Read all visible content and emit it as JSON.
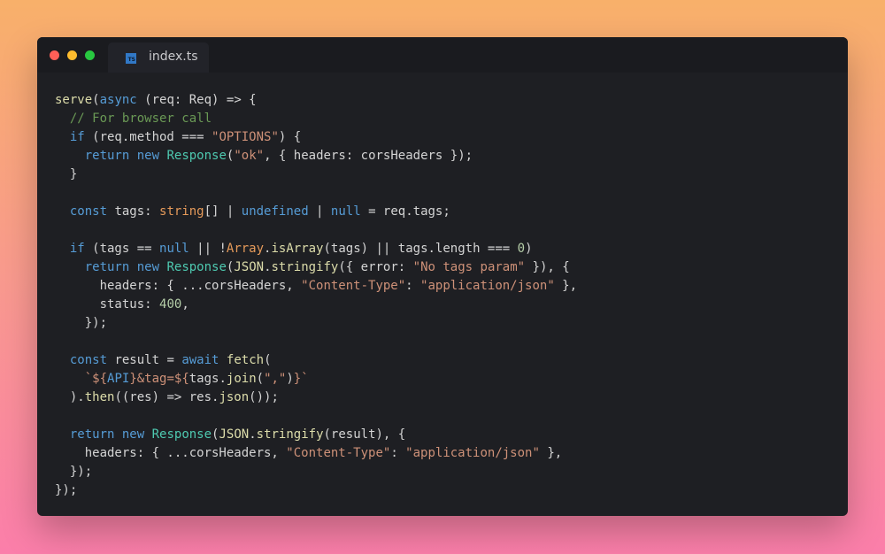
{
  "window": {
    "tab": {
      "filename": "index.ts",
      "icon": "typescript-file-icon",
      "icon_text": "TS"
    }
  },
  "colors": {
    "keyword": "#569cd6",
    "function": "#dcdcaa",
    "class": "#4ec9b0",
    "string": "#ce9178",
    "number": "#b5cea8",
    "comment": "#6a9955",
    "type": "#e59a5a",
    "plain": "#d4d4d4",
    "editor_background": "#1e1f23",
    "close_button": "#ff5f57",
    "minimize_button": "#febc2e",
    "maximize_button": "#28c840"
  },
  "code_lines": [
    [
      [
        "fn",
        "serve"
      ],
      [
        "pl",
        "("
      ],
      [
        "kw",
        "async"
      ],
      [
        "pl",
        " (req: Req) => {"
      ]
    ],
    [
      [
        "pl",
        "  "
      ],
      [
        "com",
        "// For browser call"
      ]
    ],
    [
      [
        "pl",
        "  "
      ],
      [
        "kw",
        "if"
      ],
      [
        "pl",
        " (req.method === "
      ],
      [
        "str",
        "\"OPTIONS\""
      ],
      [
        "pl",
        ") {"
      ]
    ],
    [
      [
        "pl",
        "    "
      ],
      [
        "kw",
        "return"
      ],
      [
        "pl",
        " "
      ],
      [
        "kw",
        "new"
      ],
      [
        "pl",
        " "
      ],
      [
        "cls",
        "Response"
      ],
      [
        "pl",
        "("
      ],
      [
        "str",
        "\"ok\""
      ],
      [
        "pl",
        ", { headers: corsHeaders });"
      ]
    ],
    [
      [
        "pl",
        "  }"
      ]
    ],
    [],
    [
      [
        "pl",
        "  "
      ],
      [
        "kw",
        "const"
      ],
      [
        "pl",
        " tags: "
      ],
      [
        "type",
        "string"
      ],
      [
        "pl",
        "[] | "
      ],
      [
        "kw",
        "undefined"
      ],
      [
        "pl",
        " | "
      ],
      [
        "kw",
        "null"
      ],
      [
        "pl",
        " = req.tags;"
      ]
    ],
    [],
    [
      [
        "pl",
        "  "
      ],
      [
        "kw",
        "if"
      ],
      [
        "pl",
        " (tags == "
      ],
      [
        "kw",
        "null"
      ],
      [
        "pl",
        " || !"
      ],
      [
        "type",
        "Array"
      ],
      [
        "pl",
        "."
      ],
      [
        "fn",
        "isArray"
      ],
      [
        "pl",
        "(tags) || tags.length === "
      ],
      [
        "num",
        "0"
      ],
      [
        "pl",
        ")"
      ]
    ],
    [
      [
        "pl",
        "    "
      ],
      [
        "kw",
        "return"
      ],
      [
        "pl",
        " "
      ],
      [
        "kw",
        "new"
      ],
      [
        "pl",
        " "
      ],
      [
        "cls",
        "Response"
      ],
      [
        "pl",
        "("
      ],
      [
        "fn",
        "JSON"
      ],
      [
        "pl",
        "."
      ],
      [
        "fn",
        "stringify"
      ],
      [
        "pl",
        "({ error: "
      ],
      [
        "str",
        "\"No tags param\""
      ],
      [
        "pl",
        " }), {"
      ]
    ],
    [
      [
        "pl",
        "      headers: { ...corsHeaders, "
      ],
      [
        "str",
        "\"Content-Type\""
      ],
      [
        "pl",
        ": "
      ],
      [
        "str",
        "\"application/json\""
      ],
      [
        "pl",
        " },"
      ]
    ],
    [
      [
        "pl",
        "      status: "
      ],
      [
        "num",
        "400"
      ],
      [
        "pl",
        ","
      ]
    ],
    [
      [
        "pl",
        "    });"
      ]
    ],
    [],
    [
      [
        "pl",
        "  "
      ],
      [
        "kw",
        "const"
      ],
      [
        "pl",
        " result = "
      ],
      [
        "kw",
        "await"
      ],
      [
        "pl",
        " "
      ],
      [
        "fn",
        "fetch"
      ],
      [
        "pl",
        "("
      ]
    ],
    [
      [
        "pl",
        "    "
      ],
      [
        "str",
        "`${"
      ],
      [
        "kw",
        "API"
      ],
      [
        "str",
        "}&tag=${"
      ],
      [
        "pl",
        "tags."
      ],
      [
        "fn",
        "join"
      ],
      [
        "pl",
        "("
      ],
      [
        "str",
        "\",\""
      ],
      [
        "pl",
        ")"
      ],
      [
        "str",
        "}`"
      ]
    ],
    [
      [
        "pl",
        "  )."
      ],
      [
        "fn",
        "then"
      ],
      [
        "pl",
        "((res) => res."
      ],
      [
        "fn",
        "json"
      ],
      [
        "pl",
        "());"
      ]
    ],
    [],
    [
      [
        "pl",
        "  "
      ],
      [
        "kw",
        "return"
      ],
      [
        "pl",
        " "
      ],
      [
        "kw",
        "new"
      ],
      [
        "pl",
        " "
      ],
      [
        "cls",
        "Response"
      ],
      [
        "pl",
        "("
      ],
      [
        "fn",
        "JSON"
      ],
      [
        "pl",
        "."
      ],
      [
        "fn",
        "stringify"
      ],
      [
        "pl",
        "(result), {"
      ]
    ],
    [
      [
        "pl",
        "    headers: { ...corsHeaders, "
      ],
      [
        "str",
        "\"Content-Type\""
      ],
      [
        "pl",
        ": "
      ],
      [
        "str",
        "\"application/json\""
      ],
      [
        "pl",
        " },"
      ]
    ],
    [
      [
        "pl",
        "  });"
      ]
    ],
    [
      [
        "pl",
        "});"
      ]
    ]
  ]
}
